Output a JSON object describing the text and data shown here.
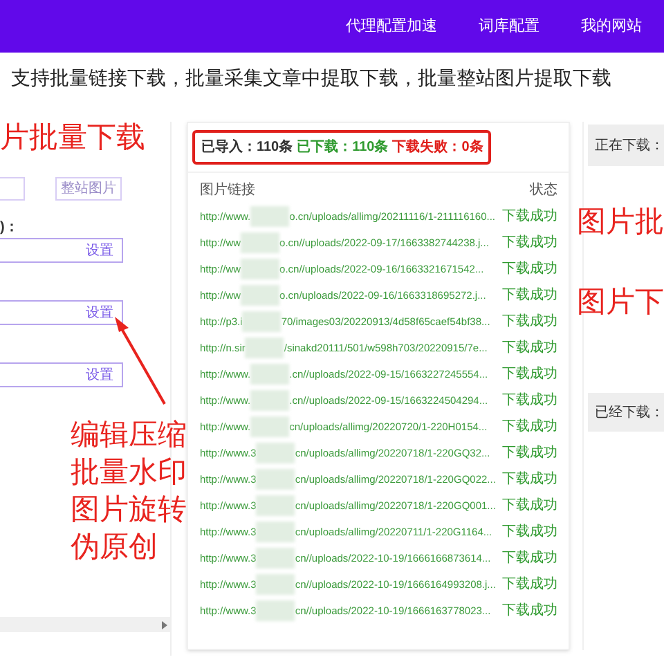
{
  "nav": {
    "items": [
      "代理配置加速",
      "词库配置",
      "我的网站"
    ]
  },
  "subtitle": "支持批量链接下载，批量采集文章中提取下载，批量整站图片提取下载",
  "left_panel": {
    "buttons": [
      "整站图片"
    ],
    "section_label": ")：",
    "fields": [
      {
        "button": "设置"
      },
      {
        "button": "设置"
      },
      {
        "button": "设置"
      }
    ]
  },
  "stats": {
    "imported": "已导入：110条",
    "downloaded": "已下载：110条",
    "failed": "下载失败：0条"
  },
  "table": {
    "columns": [
      "图片链接",
      "状态"
    ],
    "rows": [
      {
        "url_start": "http://www.",
        "url_end": "o.cn/uploads/allimg/20211116/1-211116160...",
        "status": "下载成功"
      },
      {
        "url_start": "http://ww",
        "url_end": "o.cn//uploads/2022-09-17/1663382744238.j...",
        "status": "下载成功"
      },
      {
        "url_start": "http://ww",
        "url_end": "o.cn//uploads/2022-09-16/1663321671542...",
        "status": "下载成功"
      },
      {
        "url_start": "http://ww",
        "url_end": "o.cn/uploads/2022-09-16/1663318695272.j...",
        "status": "下载成功"
      },
      {
        "url_start": "http://p3.i",
        "url_end": "70/images03/20220913/4d58f65caef54bf38...",
        "status": "下载成功"
      },
      {
        "url_start": "http://n.sir",
        "url_end": "/sinakd20111/501/w598h703/20220915/7e...",
        "status": "下载成功"
      },
      {
        "url_start": "http://www.",
        "url_end": ".cn//uploads/2022-09-15/1663227245554...",
        "status": "下载成功"
      },
      {
        "url_start": "http://www.",
        "url_end": ".cn//uploads/2022-09-15/1663224504294...",
        "status": "下载成功"
      },
      {
        "url_start": "http://www.",
        "url_end": "cn/uploads/allimg/20220720/1-220H0154...",
        "status": "下载成功"
      },
      {
        "url_start": "http://www.3",
        "url_end": "cn/uploads/allimg/20220718/1-220GQ32...",
        "status": "下载成功"
      },
      {
        "url_start": "http://www.3",
        "url_end": "cn/uploads/allimg/20220718/1-220GQ022...",
        "status": "下载成功"
      },
      {
        "url_start": "http://www.3",
        "url_end": "cn/uploads/allimg/20220718/1-220GQ001...",
        "status": "下载成功"
      },
      {
        "url_start": "http://www.3",
        "url_end": "cn/uploads/allimg/20220711/1-220G1164...",
        "status": "下载成功"
      },
      {
        "url_start": "http://www.3",
        "url_end": "cn//uploads/2022-10-19/1666166873614...",
        "status": "下载成功"
      },
      {
        "url_start": "http://www.3",
        "url_end": "cn//uploads/2022-10-19/1666164993208.j...",
        "status": "下载成功"
      },
      {
        "url_start": "http://www.3",
        "url_end": "cn//uploads/2022-10-19/1666163778023...",
        "status": "下载成功"
      }
    ]
  },
  "right_panel": {
    "downloading": "正在下载：",
    "downloaded": "已经下载："
  },
  "annotations": {
    "heading": "片批量下载",
    "right": [
      "图片批",
      "图片下"
    ],
    "features": [
      "编辑压缩",
      "批量水印",
      "图片旋转",
      "伪原创"
    ]
  }
}
